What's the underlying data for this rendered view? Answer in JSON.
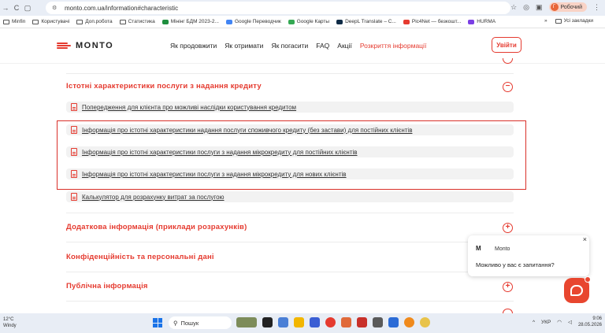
{
  "browser": {
    "url": "monto.com.ua/information#characteristic",
    "profile_label": "Робочий",
    "profile_initial": "Г",
    "bookmarks": [
      "Minfin",
      "Користувачі",
      "Доп.робота",
      "Статистика",
      "Мінінг БДМ 2023-2...",
      "Google Переводчик",
      "Google Карты",
      "DeepL Translate – С...",
      "Pic4Net — безкошт...",
      "HURMA"
    ],
    "bookmarks_more": "»",
    "all_bookmarks": "Усі закладки"
  },
  "site": {
    "logo": "MONTO",
    "nav": [
      "Як продовжити",
      "Як отримати",
      "Як погасити",
      "FAQ",
      "Акції",
      "Розкриття інформації"
    ],
    "login": "Увійти"
  },
  "content": {
    "section_open": "Істотні характеристики послуги з надання кредиту",
    "docs": [
      "Попередження для клієнта про можливі наслідки користування кредитом",
      "Інформація про істотні характеристики надання послуги споживчого кредиту (без застави) для постійних клієнтів",
      "Інформація про істотні характеристики послуги з надання мікрокредиту для постійних клієнтів",
      "Інформація про істотні характеристики послуги з надання мікрокредиту для нових клієнтів",
      "Калькулятор для розрахунку витрат за послугою"
    ],
    "sections": [
      "Додаткова інформація (приклади розрахунків)",
      "Конфіденційність та персональні дані",
      "Публічна інформація"
    ],
    "minus": "−",
    "plus": "+"
  },
  "chat": {
    "avatar": "M",
    "name": "Monto",
    "message": "Можливо у вас є запитання?",
    "close": "×"
  },
  "taskbar": {
    "temp": "12°C",
    "weather": "Windy",
    "search": "Пошук",
    "lang": "УКР",
    "time": "9:06",
    "date": "28.05.2026"
  },
  "colors": {
    "accent": "#e53a2f",
    "chat": "#e8462f"
  }
}
